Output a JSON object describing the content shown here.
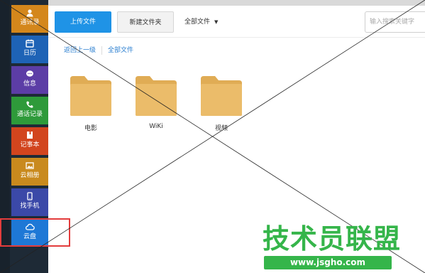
{
  "sidebar": {
    "items": [
      {
        "label": "通讯录",
        "icon": "contacts-icon",
        "color": "#d4871c"
      },
      {
        "label": "日历",
        "icon": "calendar-icon",
        "color": "#1e63b6"
      },
      {
        "label": "信息",
        "icon": "message-icon",
        "color": "#5c3da6"
      },
      {
        "label": "通话记录",
        "icon": "phone-icon",
        "color": "#2e9a3a"
      },
      {
        "label": "记事本",
        "icon": "notebook-icon",
        "color": "#d2451e"
      },
      {
        "label": "云相册",
        "icon": "photo-icon",
        "color": "#c98a1e"
      },
      {
        "label": "找手机",
        "icon": "find-phone-icon",
        "color": "#3b49a8"
      },
      {
        "label": "云盘",
        "icon": "cloud-icon",
        "color": "#1e78d6"
      }
    ],
    "highlight_color": "#e33c3c"
  },
  "toolbar": {
    "upload_label": "上传文件",
    "new_folder_label": "新建文件夹",
    "filter_label": "全部文件",
    "search_placeholder": "输入搜索关键字"
  },
  "breadcrumb": {
    "back_label": "返回上一级",
    "current_label": "全部文件"
  },
  "folders": [
    {
      "name": "电影"
    },
    {
      "name": "WiKi"
    },
    {
      "name": "视频"
    }
  ],
  "watermark": {
    "title": "技术员联盟",
    "url": "www.jsgho.com"
  },
  "colors": {
    "accent": "#1f93e6",
    "folder": "#e9b966",
    "watermark": "#35b54a"
  }
}
